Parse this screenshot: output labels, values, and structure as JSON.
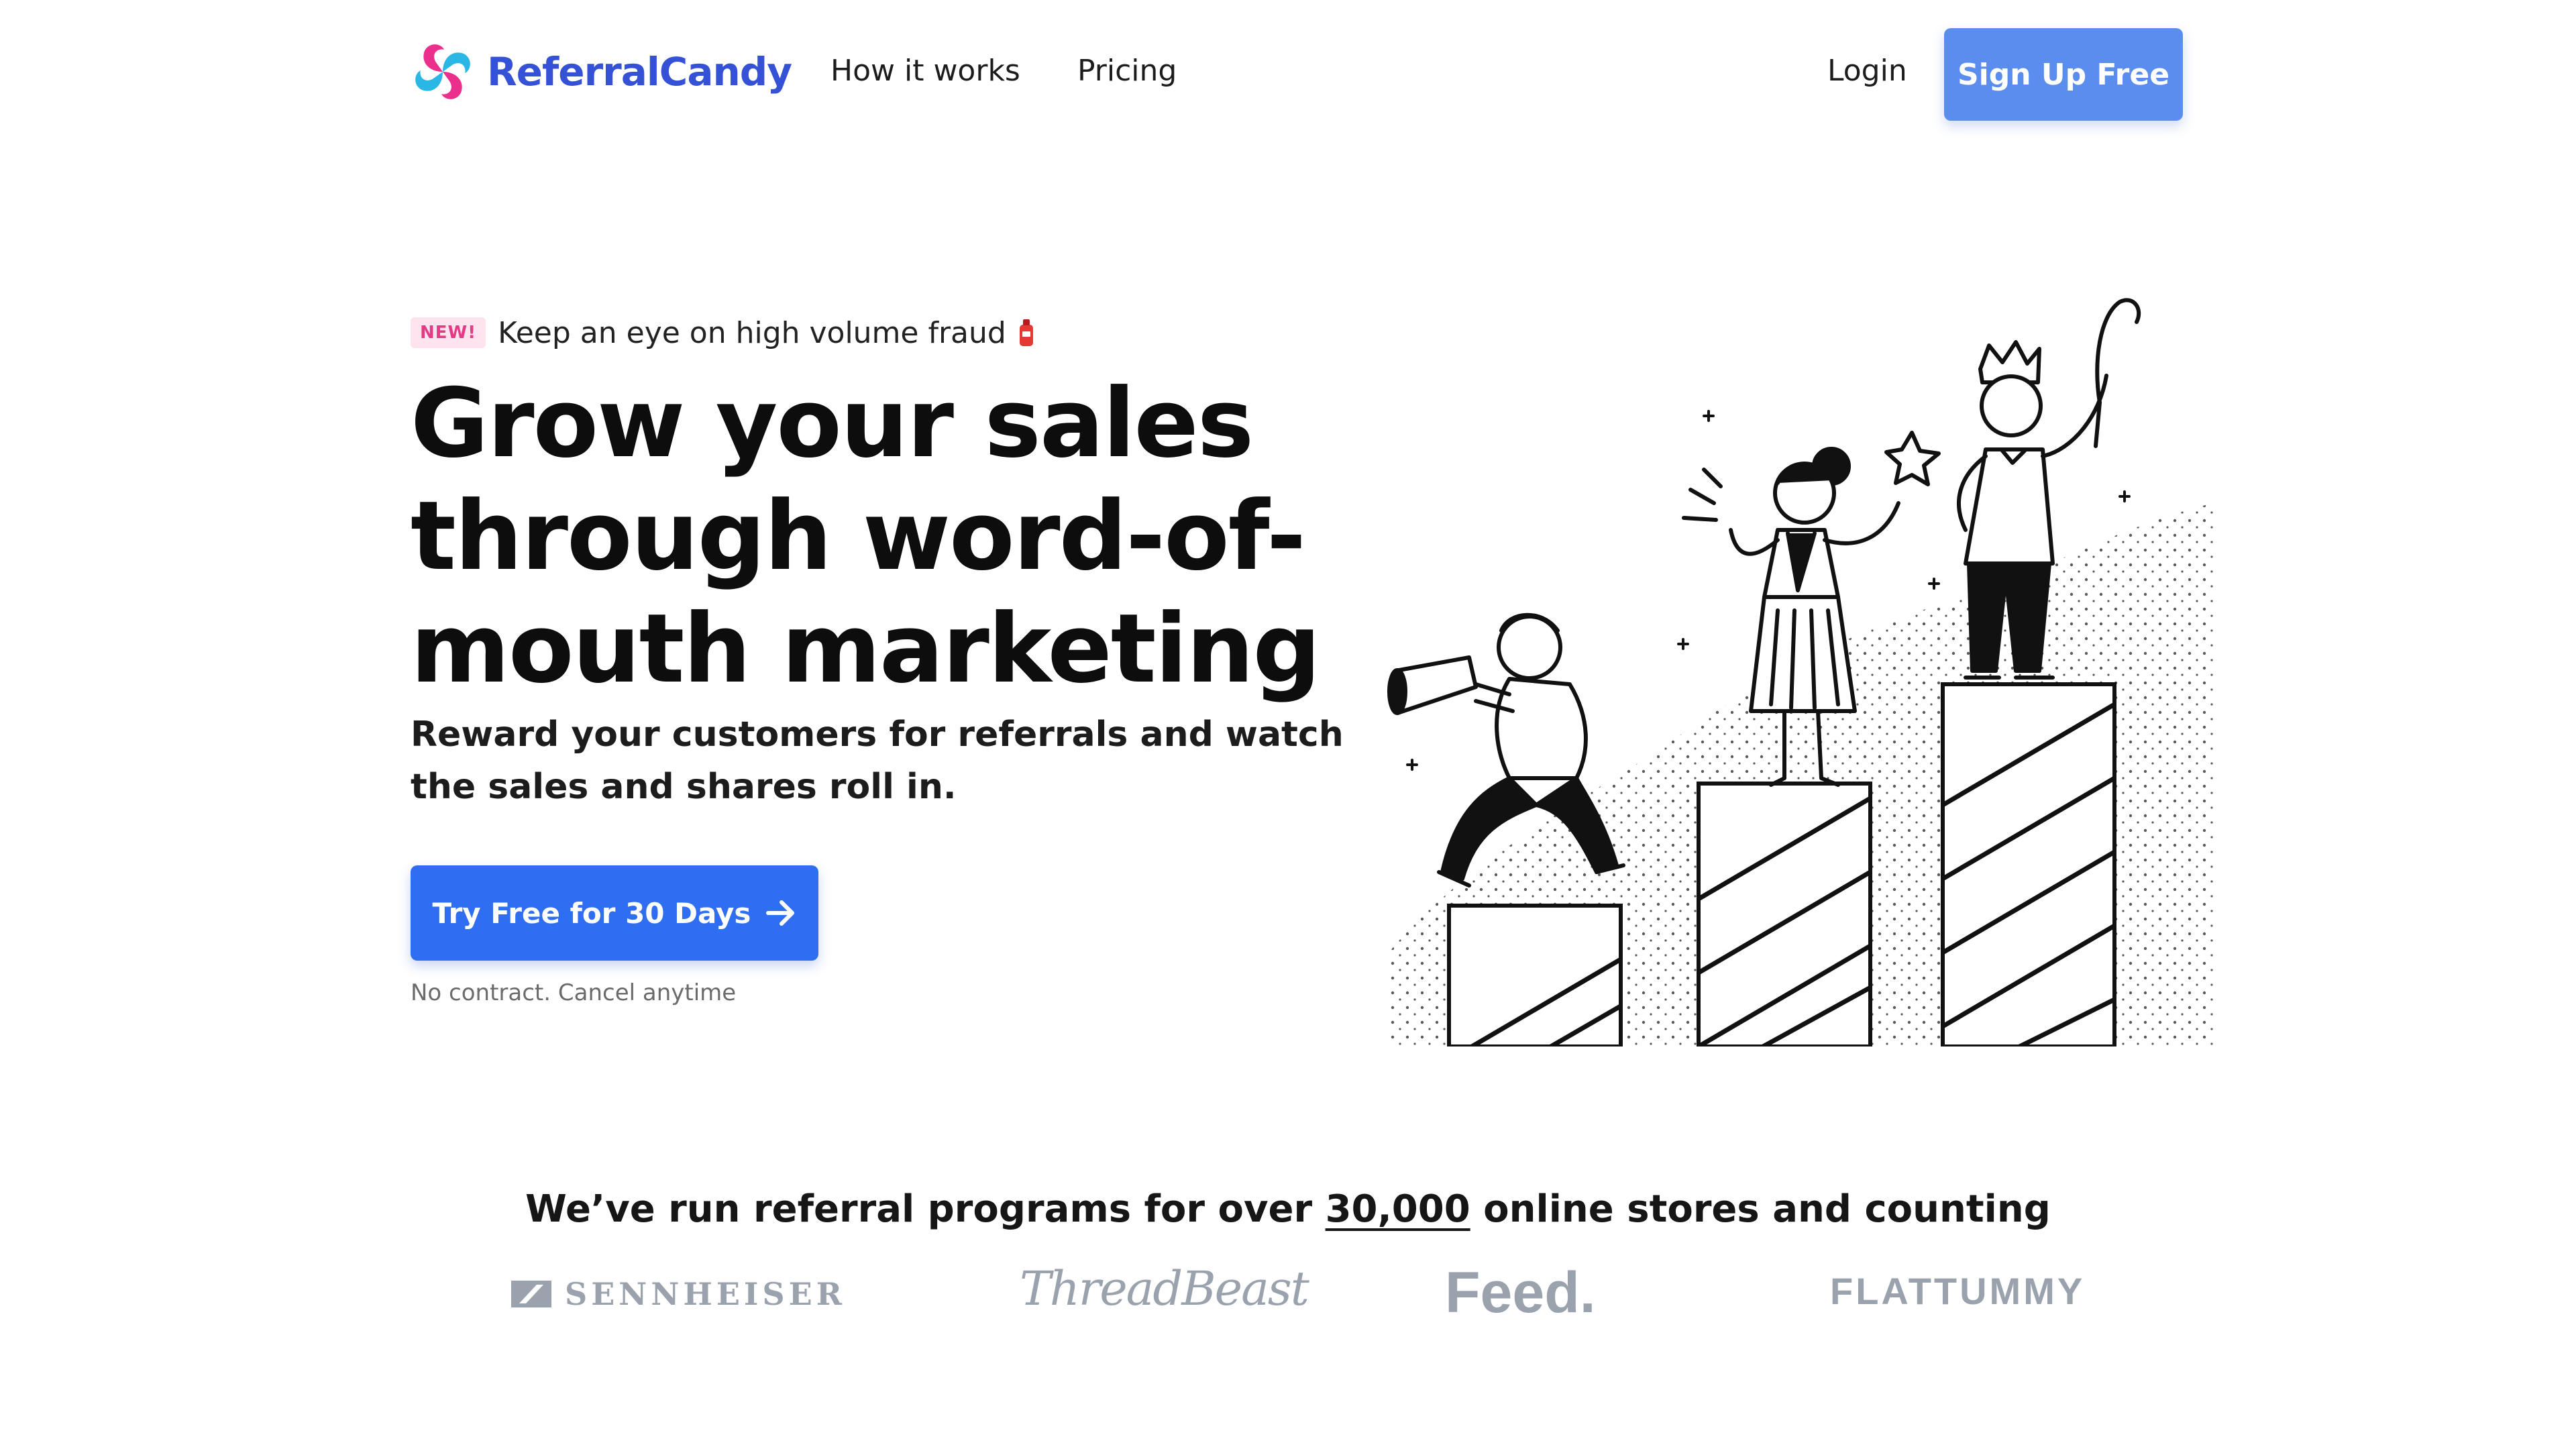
{
  "nav": {
    "brand": "ReferralCandy",
    "links": [
      {
        "label": "How it works"
      },
      {
        "label": "Pricing"
      }
    ],
    "login": "Login",
    "signup": "Sign Up Free"
  },
  "hero": {
    "badge": "NEW!",
    "announcement": "Keep an eye on high volume fraud",
    "announcement_icon": "fire-extinguisher-icon",
    "headline": "Grow your sales through word-of-mouth marketing",
    "subhead": "Reward your customers for referrals and watch the sales and shares roll in.",
    "cta": "Try Free for 30 Days",
    "cta_icon": "arrow-right-icon",
    "note": "No contract. Cancel anytime"
  },
  "trust": {
    "prefix": "We’ve run referral programs for over ",
    "count": "30,000",
    "suffix": " online stores and counting"
  },
  "brands": [
    {
      "name": "SENNHEISER"
    },
    {
      "name": "ThreadBeast"
    },
    {
      "name": "Feed."
    },
    {
      "name": "FLATTUMMY"
    }
  ],
  "colors": {
    "brand": "#3552d6",
    "signup_button": "#5b8def",
    "cta_button": "#2f6ef0",
    "badge_bg": "#ffe3ef",
    "badge_text": "#e53a84",
    "logo_gray": "#9aa2ad"
  }
}
